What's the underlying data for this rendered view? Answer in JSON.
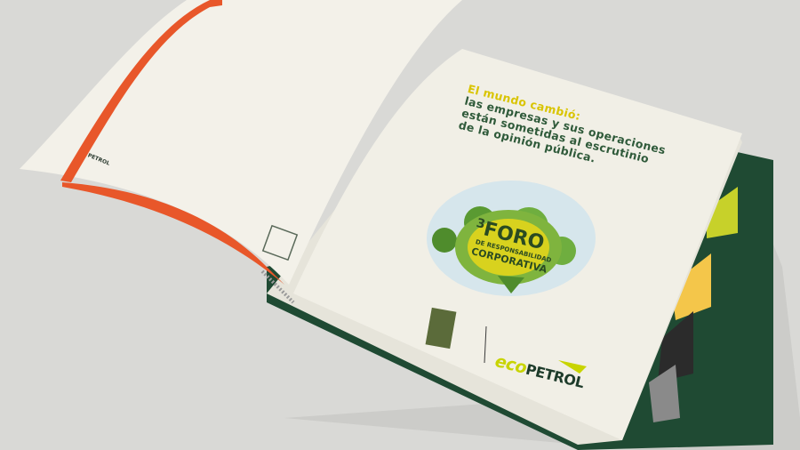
{
  "book": {
    "tagline": {
      "line1": "El mundo cambió:",
      "line2": "las empresas y sus operaciones",
      "line3": "están sometidas al escrutinio",
      "line4": "de la opinión pública."
    },
    "badge": {
      "number": "3",
      "title": "FORO",
      "subtitle1": "DE RESPONSABILIDAD",
      "subtitle2": "CORPORATIVA"
    },
    "brand": {
      "eco": "eco",
      "petrol": "PETROL"
    },
    "left_page_logo": "PETROL",
    "colors": {
      "orange_strip": "#e8572a",
      "green_cover": "#1f4a33",
      "accent_yellow": "#d9c400",
      "text_green": "#2f5a3a",
      "paper": "#f1efe6"
    }
  }
}
